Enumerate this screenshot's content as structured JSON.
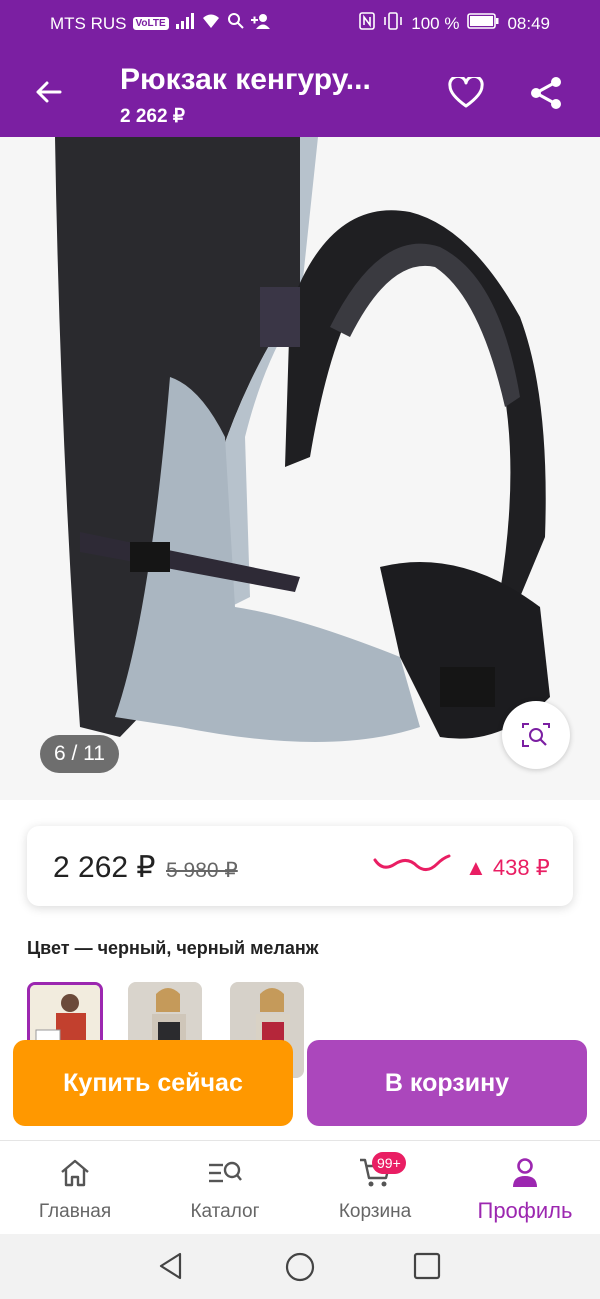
{
  "status_bar": {
    "carrier": "MTS RUS",
    "volte": "VoLTE",
    "battery": "100 %",
    "time": "08:49"
  },
  "app_bar": {
    "title": "Рюкзак кенгуру...",
    "price": "2 262 ₽",
    "icons": [
      "back-arrow-icon",
      "heart-icon",
      "share-icon"
    ]
  },
  "gallery": {
    "counter": "6 / 11",
    "icons": [
      "visual-search-icon"
    ]
  },
  "price_card": {
    "price": "2 262 ₽",
    "old_price": "5 980 ₽",
    "trend": "▲ 438 ₽",
    "trend_color": "#e91e63"
  },
  "color": {
    "label": "Цвет — черный, черный меланж",
    "thumbnail_count": 3
  },
  "actions": {
    "buy_now": "Купить сейчас",
    "add_to_cart": "В корзину",
    "buy_color": "#ff9800",
    "cart_color": "#ab47bc"
  },
  "tabs": [
    {
      "label": "Главная",
      "icon": "home-icon"
    },
    {
      "label": "Каталог",
      "icon": "catalog-search-icon"
    },
    {
      "label": "Корзина",
      "icon": "cart-icon"
    },
    {
      "label": "Профиль",
      "icon": "profile-icon",
      "active": true
    }
  ],
  "cart_badge": "99+",
  "accent_color": "#7b1fa2"
}
